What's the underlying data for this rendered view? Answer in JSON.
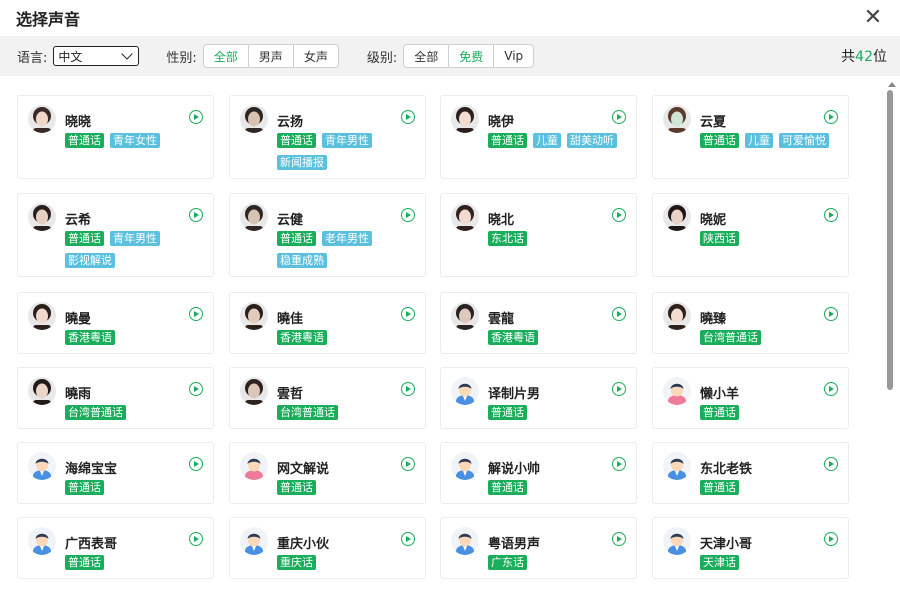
{
  "dialog": {
    "title": "选择声音"
  },
  "filters": {
    "language_label": "语言:",
    "language_value": "中文",
    "gender_label": "性别:",
    "gender_options": [
      "全部",
      "男声",
      "女声"
    ],
    "level_label": "级别:",
    "level_options": [
      "全部",
      "免费",
      "Vip"
    ],
    "count_prefix": "共",
    "count_value": "42",
    "count_suffix": "位"
  },
  "colors": {
    "accent": "#1aad5c",
    "tag_blue": "#5bc0de"
  },
  "voices": [
    {
      "name": "晓晓",
      "tags": [
        {
          "text": "普通话",
          "color": "green"
        },
        {
          "text": "青年女性",
          "color": "blue"
        }
      ]
    },
    {
      "name": "云扬",
      "tags": [
        {
          "text": "普通话",
          "color": "green"
        },
        {
          "text": "青年男性",
          "color": "blue"
        },
        {
          "text": "新闻播报",
          "color": "blue"
        }
      ]
    },
    {
      "name": "晓伊",
      "tags": [
        {
          "text": "普通话",
          "color": "green"
        },
        {
          "text": "儿童",
          "color": "blue"
        },
        {
          "text": "甜美动听",
          "color": "blue"
        }
      ]
    },
    {
      "name": "云夏",
      "tags": [
        {
          "text": "普通话",
          "color": "green"
        },
        {
          "text": "儿童",
          "color": "blue"
        },
        {
          "text": "可爱愉悦",
          "color": "blue"
        }
      ]
    },
    {
      "name": "云希",
      "tags": [
        {
          "text": "普通话",
          "color": "green"
        },
        {
          "text": "青年男性",
          "color": "blue"
        },
        {
          "text": "影视解说",
          "color": "blue"
        }
      ]
    },
    {
      "name": "云健",
      "tags": [
        {
          "text": "普通话",
          "color": "green"
        },
        {
          "text": "老年男性",
          "color": "blue"
        },
        {
          "text": "稳重成熟",
          "color": "blue"
        }
      ]
    },
    {
      "name": "晓北",
      "tags": [
        {
          "text": "东北话",
          "color": "green"
        }
      ]
    },
    {
      "name": "晓妮",
      "tags": [
        {
          "text": "陕西话",
          "color": "green"
        }
      ]
    },
    {
      "name": "曉曼",
      "tags": [
        {
          "text": "香港粵语",
          "color": "green"
        }
      ]
    },
    {
      "name": "曉佳",
      "tags": [
        {
          "text": "香港粵语",
          "color": "green"
        }
      ]
    },
    {
      "name": "雲龍",
      "tags": [
        {
          "text": "香港粵语",
          "color": "green"
        }
      ]
    },
    {
      "name": "曉臻",
      "tags": [
        {
          "text": "台湾普通话",
          "color": "green"
        }
      ]
    },
    {
      "name": "曉雨",
      "tags": [
        {
          "text": "台湾普通话",
          "color": "green"
        }
      ]
    },
    {
      "name": "雲哲",
      "tags": [
        {
          "text": "台湾普通话",
          "color": "green"
        }
      ]
    },
    {
      "name": "译制片男",
      "tags": [
        {
          "text": "普通话",
          "color": "green"
        }
      ]
    },
    {
      "name": "懒小羊",
      "tags": [
        {
          "text": "普通话",
          "color": "green"
        }
      ]
    },
    {
      "name": "海绵宝宝",
      "tags": [
        {
          "text": "普通话",
          "color": "green"
        }
      ]
    },
    {
      "name": "网文解说",
      "tags": [
        {
          "text": "普通话",
          "color": "green"
        }
      ]
    },
    {
      "name": "解说小帅",
      "tags": [
        {
          "text": "普通话",
          "color": "green"
        }
      ]
    },
    {
      "name": "东北老铁",
      "tags": [
        {
          "text": "普通话",
          "color": "green"
        }
      ]
    },
    {
      "name": "广西表哥",
      "tags": [
        {
          "text": "普通话",
          "color": "green"
        }
      ]
    },
    {
      "name": "重庆小伙",
      "tags": [
        {
          "text": "重庆话",
          "color": "green"
        }
      ]
    },
    {
      "name": "粤语男声",
      "tags": [
        {
          "text": "广东话",
          "color": "green"
        }
      ]
    },
    {
      "name": "天津小哥",
      "tags": [
        {
          "text": "天津话",
          "color": "green"
        }
      ]
    }
  ]
}
